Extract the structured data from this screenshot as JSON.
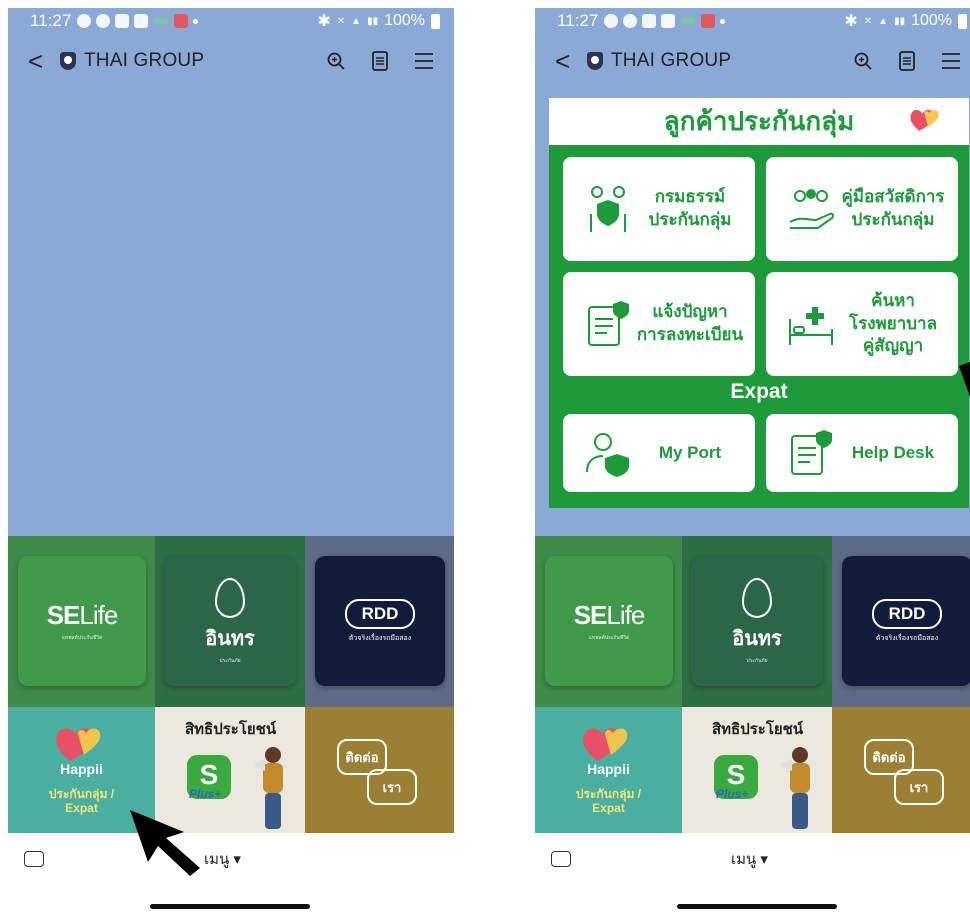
{
  "status": {
    "time": "11:27",
    "battery": "100%"
  },
  "header": {
    "back": "<",
    "title": "THAI GROUP"
  },
  "menu": {
    "selife": {
      "brand_bold": "SE",
      "brand_light": "Life",
      "sub": "แทพลต์ประกันชีวิต"
    },
    "inthra": {
      "name": "อินทร",
      "sub": "ประกันภัย"
    },
    "rdd": {
      "badge": "RDD",
      "sub": "ตัวจริงเรื่องรถมือสอง"
    },
    "happii": {
      "word": "Happii",
      "line1": "ประกันกลุ่ม /",
      "line2": "Expat"
    },
    "rights": {
      "title": "สิทธิประโยชน์",
      "app_letter": "S",
      "plus": "Plus+"
    },
    "contact": {
      "line1": "ติดต่อ",
      "line2": "เรา"
    }
  },
  "bottom": {
    "menu_label": "เมนู ▾"
  },
  "card": {
    "title": "ลูกค้าประกันกลุ่ม",
    "buttons": [
      {
        "label_1": "กรมธรรม์",
        "label_2": "ประกันกลุ่ม"
      },
      {
        "label_1": "คู่มือสวัสดิการ",
        "label_2": "ประกันกลุ่ม"
      },
      {
        "label_1": "แจ้งปัญหา",
        "label_2": "การลงทะเบียน"
      },
      {
        "label_1": "ค้นหา",
        "label_2": "โรงพยาบาล",
        "label_3": "คู่สัญญา"
      }
    ],
    "expat_label": "Expat",
    "expat_buttons": [
      {
        "label": "My Port"
      },
      {
        "label": "Help Desk"
      }
    ]
  }
}
